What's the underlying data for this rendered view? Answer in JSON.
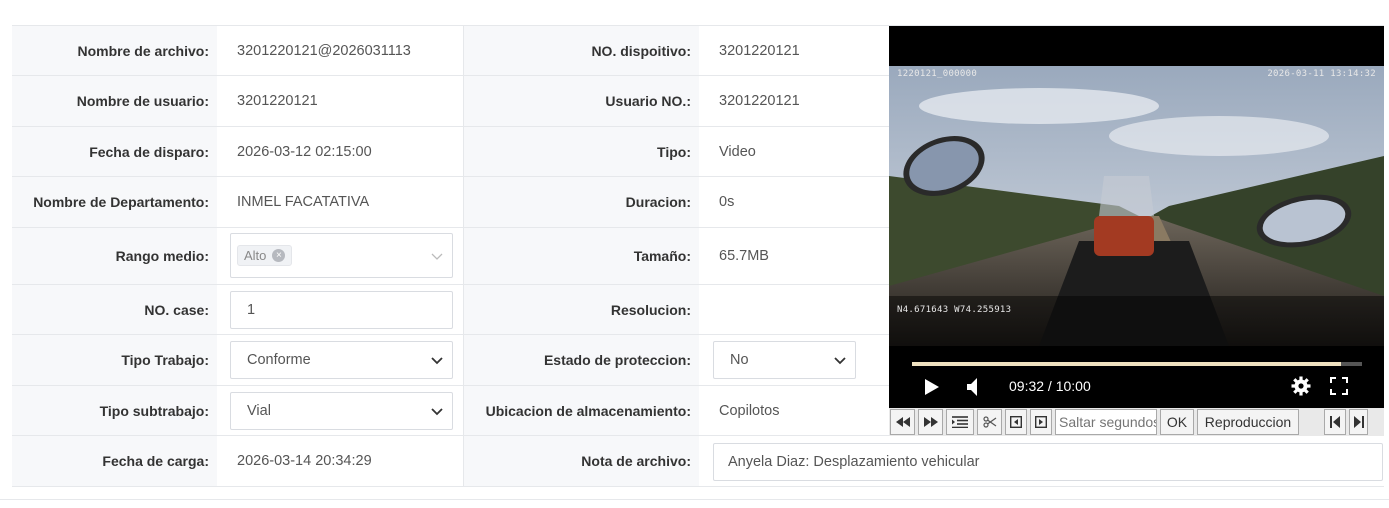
{
  "fields": {
    "filename": {
      "label": "Nombre de archivo:",
      "value": "3201220121@2026031113"
    },
    "device_no": {
      "label": "NO. dispoitivo:",
      "value": "3201220121"
    },
    "username": {
      "label": "Nombre de usuario:",
      "value": "3201220121"
    },
    "user_no": {
      "label": "Usuario NO.:",
      "value": "3201220121"
    },
    "shot_date": {
      "label": "Fecha de disparo:",
      "value": "2026-03-12 02:15:00"
    },
    "type": {
      "label": "Tipo:",
      "value": "Video"
    },
    "department": {
      "label": "Nombre de Departamento:",
      "value": "INMEL FACATATIVA"
    },
    "duration": {
      "label": "Duracion:",
      "value": "0s"
    },
    "range": {
      "label": "Rango medio:",
      "tag": "Alto"
    },
    "size": {
      "label": "Tamaño:",
      "value": "65.7MB"
    },
    "case_no": {
      "label": "NO. case:",
      "value": "1"
    },
    "resolution": {
      "label": "Resolucion:",
      "value": ""
    },
    "work_type": {
      "label": "Tipo Trabajo:",
      "value": "Conforme"
    },
    "protection": {
      "label": "Estado de proteccion:",
      "value": "No"
    },
    "subwork_type": {
      "label": "Tipo subtrabajo:",
      "value": "Vial"
    },
    "storage": {
      "label": "Ubicacion de almacenamiento:",
      "value": "Copilotos"
    },
    "upload_date": {
      "label": "Fecha de carga:",
      "value": "2026-03-14 20:34:29"
    },
    "file_note": {
      "label": "Nota de archivo:",
      "value": "Anyela Diaz: Desplazamiento vehicular"
    }
  },
  "video": {
    "osd_id": "1220121_000000",
    "osd_datetime": "2026-03-11 13:14:32",
    "osd_gps": "N4.671643  W74.255913",
    "time_display": "09:32 / 10:00",
    "progress": 0.953
  },
  "toolbar": {
    "seek_placeholder": "Saltar segundos",
    "ok_label": "OK",
    "playback_label": "Reproduccion"
  },
  "icons": [
    "rewind-icon",
    "fast-forward-icon",
    "list-icon",
    "scissors-icon",
    "frame-back-icon",
    "frame-forward-icon",
    "skip-start-icon",
    "skip-end-icon",
    "play-icon",
    "volume-icon",
    "gear-icon",
    "fullscreen-icon",
    "chevron-down-icon",
    "close-icon"
  ]
}
